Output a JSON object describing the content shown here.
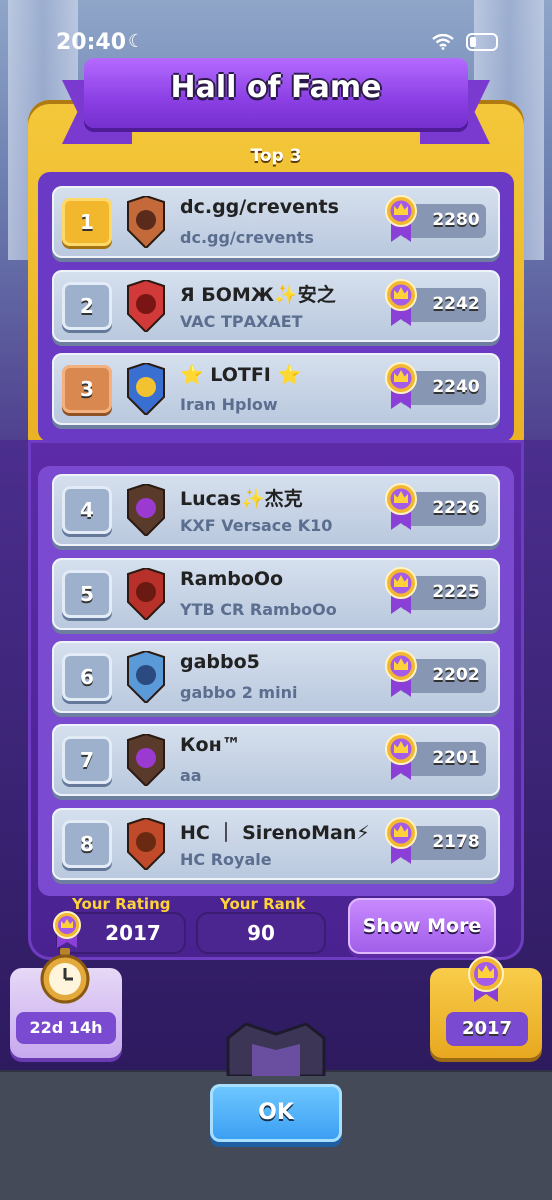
{
  "status_bar": {
    "time": "20:40"
  },
  "header": {
    "title": "Hall of Fame",
    "section_label": "Top 3"
  },
  "players": [
    {
      "rank": "1",
      "name": "dc.gg/crevents",
      "clan": "dc.gg/crevents",
      "trophies": "2280",
      "rank_style": "gold",
      "badge_icon": "king-avatar-icon"
    },
    {
      "rank": "2",
      "name": "Я БОМЖ✨安之",
      "clan": "VAC ТРАХАЕТ",
      "trophies": "2242",
      "rank_style": "silver",
      "badge_icon": "red-fan-clan-badge-icon"
    },
    {
      "rank": "3",
      "name": "⭐ LOTFI ⭐",
      "clan": "Iran Hplow",
      "trophies": "2240",
      "rank_style": "bronze",
      "badge_icon": "blue-star-clan-badge-icon"
    },
    {
      "rank": "4",
      "name": "Lucas✨杰克",
      "clan": "KXF Versace K10",
      "trophies": "2226",
      "rank_style": "silver",
      "badge_icon": "purple-drop-clan-badge-icon"
    },
    {
      "rank": "5",
      "name": "RamboOo",
      "clan": "YTB CR RamboOo",
      "trophies": "2225",
      "rank_style": "silver",
      "badge_icon": "crescent-clan-badge-icon"
    },
    {
      "rank": "6",
      "name": "gabbo5",
      "clan": "gabbo 2 mini",
      "trophies": "2202",
      "rank_style": "silver",
      "badge_icon": "blue-tower-clan-badge-icon"
    },
    {
      "rank": "7",
      "name": "Кон™",
      "clan": "aa",
      "trophies": "2201",
      "rank_style": "silver",
      "badge_icon": "purple-drop-clan-badge-icon"
    },
    {
      "rank": "8",
      "name": "HC ｜ SirenoMan⚡",
      "clan": "HC Royale",
      "trophies": "2178",
      "rank_style": "silver",
      "badge_icon": "hammer-clan-badge-icon"
    }
  ],
  "footer": {
    "your_rating_label": "Your Rating",
    "your_rating_value": "2017",
    "your_rank_label": "Your Rank",
    "your_rank_value": "90",
    "show_more_label": "Show More",
    "timer_value": "22d 14h",
    "rating_card_value": "2017",
    "ok_label": "OK"
  },
  "colors": {
    "gold_panel": "#f4c73a",
    "purple_panel": "#5d2ba8",
    "ok_button": "#3a9df2",
    "rating_label": "#ffd23a",
    "rank_label": "#ffd23a"
  }
}
